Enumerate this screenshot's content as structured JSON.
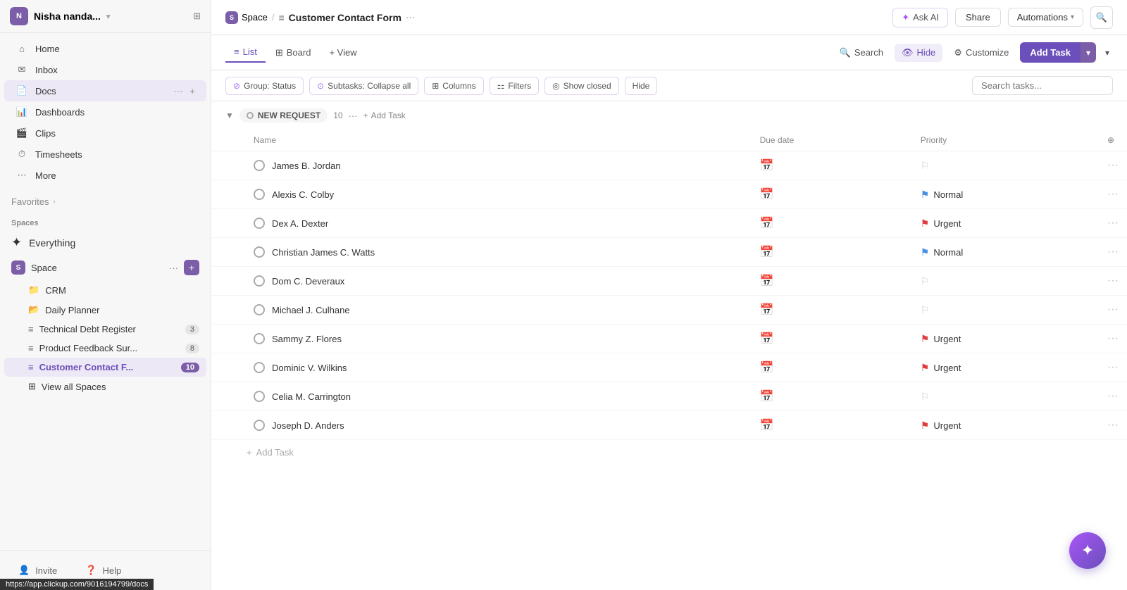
{
  "sidebar": {
    "user": {
      "initials": "N",
      "name": "Nisha nanda...",
      "avatar_color": "#7b5ea7"
    },
    "nav": [
      {
        "id": "home",
        "label": "Home",
        "icon": "⌂"
      },
      {
        "id": "inbox",
        "label": "Inbox",
        "icon": "✉"
      },
      {
        "id": "docs",
        "label": "Docs",
        "icon": "📄"
      },
      {
        "id": "dashboards",
        "label": "Dashboards",
        "icon": "📊"
      },
      {
        "id": "clips",
        "label": "Clips",
        "icon": "🎬"
      },
      {
        "id": "timesheets",
        "label": "Timesheets",
        "icon": "⏱"
      },
      {
        "id": "more",
        "label": "More",
        "icon": "⋯"
      }
    ],
    "favorites_label": "Favorites",
    "spaces_label": "Spaces",
    "everything_label": "Everything",
    "space_name": "Space",
    "space_initial": "S",
    "sub_items": [
      {
        "id": "crm",
        "label": "CRM",
        "icon": "📁",
        "badge": null,
        "active": false
      },
      {
        "id": "daily-planner",
        "label": "Daily Planner",
        "icon": "📂",
        "badge": null,
        "active": false
      },
      {
        "id": "technical-debt",
        "label": "Technical Debt Register",
        "icon": "≡",
        "badge": "3",
        "active": false
      },
      {
        "id": "product-feedback",
        "label": "Product Feedback Sur...",
        "icon": "≡",
        "badge": "8",
        "active": false
      },
      {
        "id": "customer-contact",
        "label": "Customer Contact F...",
        "icon": "≡",
        "badge": "10",
        "active": true
      }
    ],
    "view_all_spaces": "View all Spaces",
    "invite": "Invite",
    "help": "Help"
  },
  "topbar": {
    "space_label": "Space",
    "space_initial": "S",
    "breadcrumb_sep": "/",
    "page_icon": "≡",
    "page_title": "Customer Contact Form",
    "more": "···",
    "ask_ai": "Ask AI",
    "share": "Share",
    "automations": "Automations",
    "search_icon": "🔍"
  },
  "toolbar": {
    "tabs": [
      {
        "id": "list",
        "label": "List",
        "icon": "≡",
        "active": true
      },
      {
        "id": "board",
        "label": "Board",
        "icon": "⊞",
        "active": false
      },
      {
        "id": "view",
        "label": "+ View",
        "icon": "",
        "active": false
      }
    ],
    "search_label": "Search",
    "hide_label": "Hide",
    "customize_label": "Customize",
    "add_task_label": "Add Task",
    "more_options": "···"
  },
  "filterbar": {
    "group_status": "Group: Status",
    "subtasks": "Subtasks: Collapse all",
    "columns": "Columns",
    "filters": "Filters",
    "show_closed": "Show closed",
    "hide": "Hide",
    "search_placeholder": "Search tasks..."
  },
  "group": {
    "status_label": "NEW REQUEST",
    "count": 10,
    "add_task": "Add Task"
  },
  "table": {
    "columns": [
      {
        "id": "name",
        "label": "Name"
      },
      {
        "id": "due_date",
        "label": "Due date"
      },
      {
        "id": "priority",
        "label": "Priority"
      }
    ],
    "rows": [
      {
        "id": 1,
        "name": "James B. Jordan",
        "due_date": null,
        "priority": null,
        "priority_label": ""
      },
      {
        "id": 2,
        "name": "Alexis C. Colby",
        "due_date": null,
        "priority": "normal",
        "priority_label": "Normal"
      },
      {
        "id": 3,
        "name": "Dex A. Dexter",
        "due_date": null,
        "priority": "urgent",
        "priority_label": "Urgent"
      },
      {
        "id": 4,
        "name": "Christian James C. Watts",
        "due_date": null,
        "priority": "normal",
        "priority_label": "Normal"
      },
      {
        "id": 5,
        "name": "Dom C. Deveraux",
        "due_date": null,
        "priority": null,
        "priority_label": ""
      },
      {
        "id": 6,
        "name": "Michael J. Culhane",
        "due_date": null,
        "priority": null,
        "priority_label": ""
      },
      {
        "id": 7,
        "name": "Sammy Z. Flores",
        "due_date": null,
        "priority": "urgent",
        "priority_label": "Urgent"
      },
      {
        "id": 8,
        "name": "Dominic V. Wilkins",
        "due_date": null,
        "priority": "urgent",
        "priority_label": "Urgent"
      },
      {
        "id": 9,
        "name": "Celia M. Carrington",
        "due_date": null,
        "priority": null,
        "priority_label": ""
      },
      {
        "id": 10,
        "name": "Joseph D. Anders",
        "due_date": null,
        "priority": "urgent",
        "priority_label": "Urgent"
      }
    ]
  },
  "url_bar": "https://app.clickup.com/9016194799/docs",
  "colors": {
    "accent": "#6b4fbb",
    "urgent": "#e03e3e",
    "normal": "#4a90e2"
  }
}
